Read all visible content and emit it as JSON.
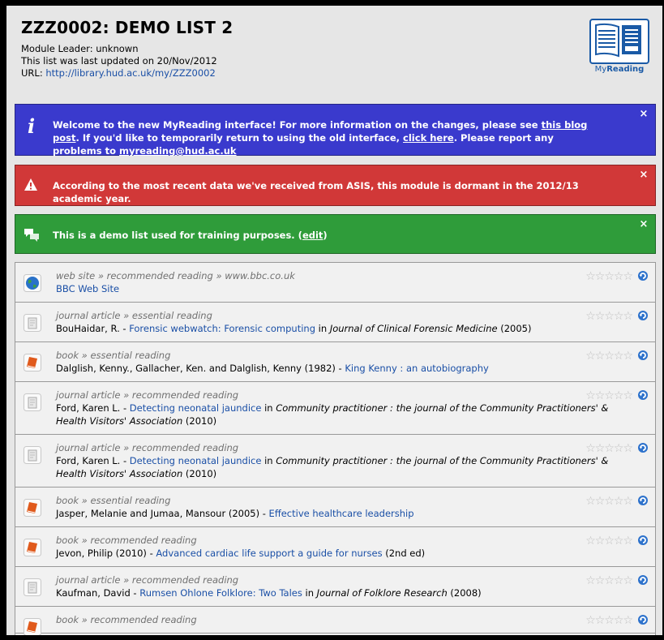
{
  "header": {
    "title": "ZZZ0002: DEMO LIST 2",
    "leader": "Module Leader: unknown",
    "updated": "This list was last updated on 20/Nov/2012",
    "url_label": "URL: ",
    "url": "http://library.hud.ac.uk/my/ZZZ0002"
  },
  "logo": {
    "part1": "My",
    "part2": "Reading"
  },
  "banners": {
    "info": {
      "t1": "Welcome to the new MyReading interface! For more information on the changes, please see ",
      "link1": "this blog post",
      "t2": ". If you'd like to temporarily return to using the old interface, ",
      "link2": "click here",
      "t3": ". Please report any problems to ",
      "link3": "myreading@hud.ac.uk",
      "close": "×"
    },
    "warn": {
      "text": "According to the most recent data we've received from ASIS, this module is dormant in the 2012/13 academic year.",
      "close": "×"
    },
    "note": {
      "text": "This is a demo list used for training purposes. (",
      "link": "edit",
      "text_end": ")",
      "close": "×"
    }
  },
  "items": [
    {
      "icon": "globe-icon",
      "category": "web site » recommended reading » www.bbc.co.uk",
      "pre": "",
      "title": "BBC Web Site",
      "mid": "",
      "container": "",
      "post": ""
    },
    {
      "icon": "journal-icon",
      "category": "journal article » essential reading",
      "pre": "BouHaidar, R. - ",
      "title": "Forensic webwatch: Forensic computing",
      "mid": " in ",
      "container": "Journal of Clinical Forensic Medicine",
      "post": " (2005)"
    },
    {
      "icon": "book-icon",
      "category": "book » essential reading",
      "pre": "Dalglish, Kenny., Gallacher, Ken. and Dalglish, Kenny (1982) - ",
      "title": "King Kenny : an autobiography",
      "mid": "",
      "container": "",
      "post": ""
    },
    {
      "icon": "journal-icon",
      "category": "journal article » recommended reading",
      "pre": "Ford, Karen L. - ",
      "title": "Detecting neonatal jaundice",
      "mid": " in ",
      "container": "Community practitioner : the journal of the Community Practitioners' & Health Visitors' Association",
      "post": " (2010)"
    },
    {
      "icon": "journal-icon",
      "category": "journal article » recommended reading",
      "pre": "Ford, Karen L. - ",
      "title": "Detecting neonatal jaundice",
      "mid": " in ",
      "container": "Community practitioner : the journal of the Community Practitioners' & Health Visitors' Association",
      "post": " (2010)"
    },
    {
      "icon": "book-icon",
      "category": "book » essential reading",
      "pre": "Jasper, Melanie and Jumaa, Mansour (2005) - ",
      "title": "Effective healthcare leadership",
      "mid": "",
      "container": "",
      "post": ""
    },
    {
      "icon": "book-icon",
      "category": "book » recommended reading",
      "pre": "Jevon, Philip (2010) - ",
      "title": "Advanced cardiac life support a guide for nurses",
      "mid": "",
      "container": "",
      "post": " (2nd ed)"
    },
    {
      "icon": "journal-icon",
      "category": "journal article » recommended reading",
      "pre": "Kaufman, David - ",
      "title": "Rumsen Ohlone Folklore: Two Tales",
      "mid": " in ",
      "container": "Journal of Folklore Research",
      "post": " (2008)"
    },
    {
      "icon": "book-icon",
      "category": "book » recommended reading",
      "pre": "",
      "title": "",
      "mid": "",
      "container": "",
      "post": ""
    }
  ],
  "rating_glyph": "☆"
}
